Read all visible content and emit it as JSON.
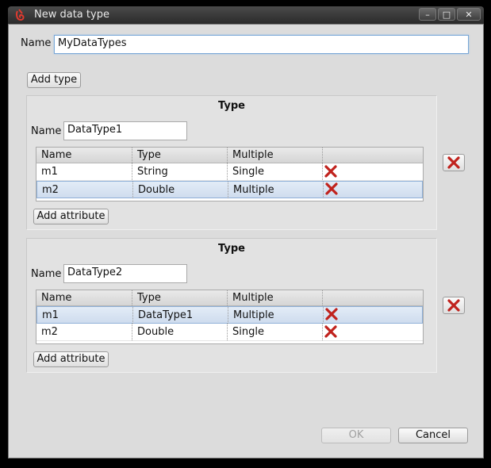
{
  "window": {
    "title": "New data type",
    "minimize_icon": "minimize-icon",
    "maximize_icon": "maximize-icon",
    "close_icon": "close-icon"
  },
  "form": {
    "name_label": "Name",
    "name_value": "MyDataTypes",
    "add_type_label": "Add type"
  },
  "types": [
    {
      "title": "Type",
      "name_label": "Name",
      "name_value": "DataType1",
      "columns": [
        "Name",
        "Type",
        "Multiple",
        ""
      ],
      "rows": [
        {
          "name": "m1",
          "type": "String",
          "multiple": "Single"
        },
        {
          "name": "m2",
          "type": "Double",
          "multiple": "Multiple"
        }
      ],
      "add_attribute_label": "Add attribute"
    },
    {
      "title": "Type",
      "name_label": "Name",
      "name_value": "DataType2",
      "columns": [
        "Name",
        "Type",
        "Multiple",
        ""
      ],
      "rows": [
        {
          "name": "m1",
          "type": "DataType1",
          "multiple": "Multiple"
        },
        {
          "name": "m2",
          "type": "Double",
          "multiple": "Single"
        }
      ],
      "add_attribute_label": "Add attribute"
    }
  ],
  "footer": {
    "ok_label": "OK",
    "cancel_label": "Cancel"
  },
  "colors": {
    "delete_red": "#c0221d",
    "selection": "#cfdcee"
  }
}
